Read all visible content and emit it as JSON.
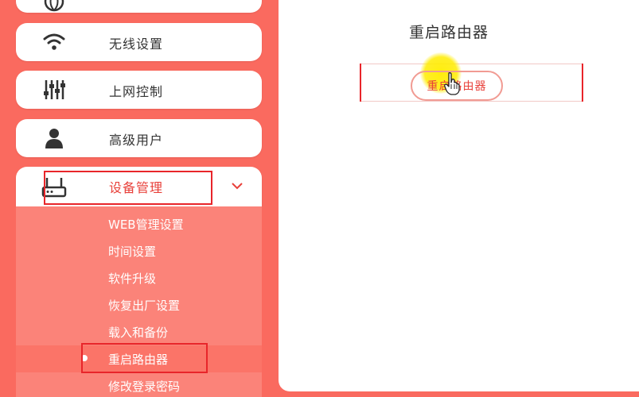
{
  "sidebar": {
    "items": [
      {
        "label": "无线设置",
        "icon": "wifi-icon"
      },
      {
        "label": "上网控制",
        "icon": "sliders-icon"
      },
      {
        "label": "高级用户",
        "icon": "user-icon"
      },
      {
        "label": "设备管理",
        "icon": "router-icon",
        "expanded": true
      }
    ],
    "submenu": [
      "WEB管理设置",
      "时间设置",
      "软件升级",
      "恢复出厂设置",
      "载入和备份",
      "重启路由器",
      "修改登录密码"
    ],
    "active_submenu": "重启路由器"
  },
  "main": {
    "title": "重启路由器",
    "reboot_button_label": "重启路由器"
  },
  "colors": {
    "sidebar_bg": "#fa6a5f",
    "submenu_bg": "#fb8379",
    "annotation_red": "#e8252a",
    "button_text": "#e8403a"
  }
}
